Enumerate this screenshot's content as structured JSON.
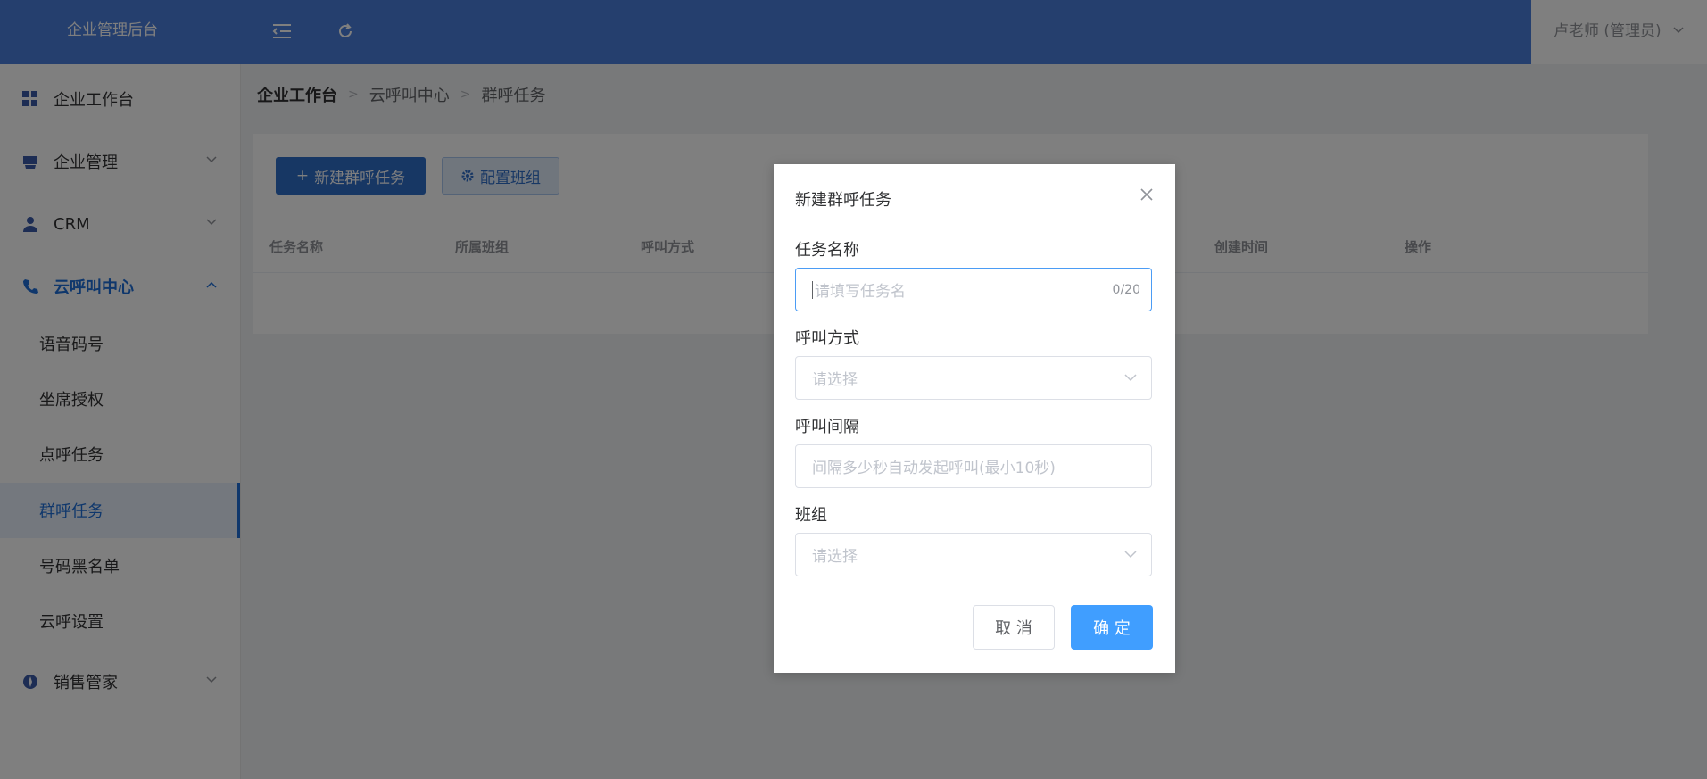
{
  "app": {
    "title": "企业管理后台"
  },
  "header": {
    "user_label": "卢老师 (管理员)"
  },
  "sidebar": {
    "items": [
      {
        "label": "企业工作台",
        "icon": "grid-icon"
      },
      {
        "label": "企业管理",
        "icon": "inbox-icon"
      },
      {
        "label": "CRM",
        "icon": "user-icon"
      },
      {
        "label": "云呼叫中心",
        "icon": "phone-icon",
        "expanded": true
      },
      {
        "label": "销售管家",
        "icon": "compass-icon"
      }
    ],
    "sub_items": [
      {
        "label": "语音码号"
      },
      {
        "label": "坐席授权"
      },
      {
        "label": "点呼任务"
      },
      {
        "label": "群呼任务",
        "active": true
      },
      {
        "label": "号码黑名单"
      },
      {
        "label": "云呼设置"
      }
    ]
  },
  "breadcrumb": [
    "企业工作台",
    "云呼叫中心",
    "群呼任务"
  ],
  "toolbar": {
    "new_task_label": "新建群呼任务",
    "config_group_label": "配置班组"
  },
  "table": {
    "columns": [
      "任务名称",
      "所属班组",
      "呼叫方式",
      "创建时间",
      "操作"
    ]
  },
  "dialog": {
    "title": "新建群呼任务",
    "fields": {
      "task_name": {
        "label": "任务名称",
        "placeholder": "请填写任务名",
        "counter": "0/20"
      },
      "call_mode": {
        "label": "呼叫方式",
        "placeholder": "请选择"
      },
      "call_interval": {
        "label": "呼叫间隔",
        "placeholder": "间隔多少秒自动发起呼叫(最小10秒)"
      },
      "group": {
        "label": "班组",
        "placeholder": "请选择"
      }
    },
    "cancel_label": "取 消",
    "confirm_label": "确 定"
  },
  "colors": {
    "header_bg": "#4b7fdc",
    "active_blue": "#1e6fd9",
    "primary_button": "#409eff"
  }
}
